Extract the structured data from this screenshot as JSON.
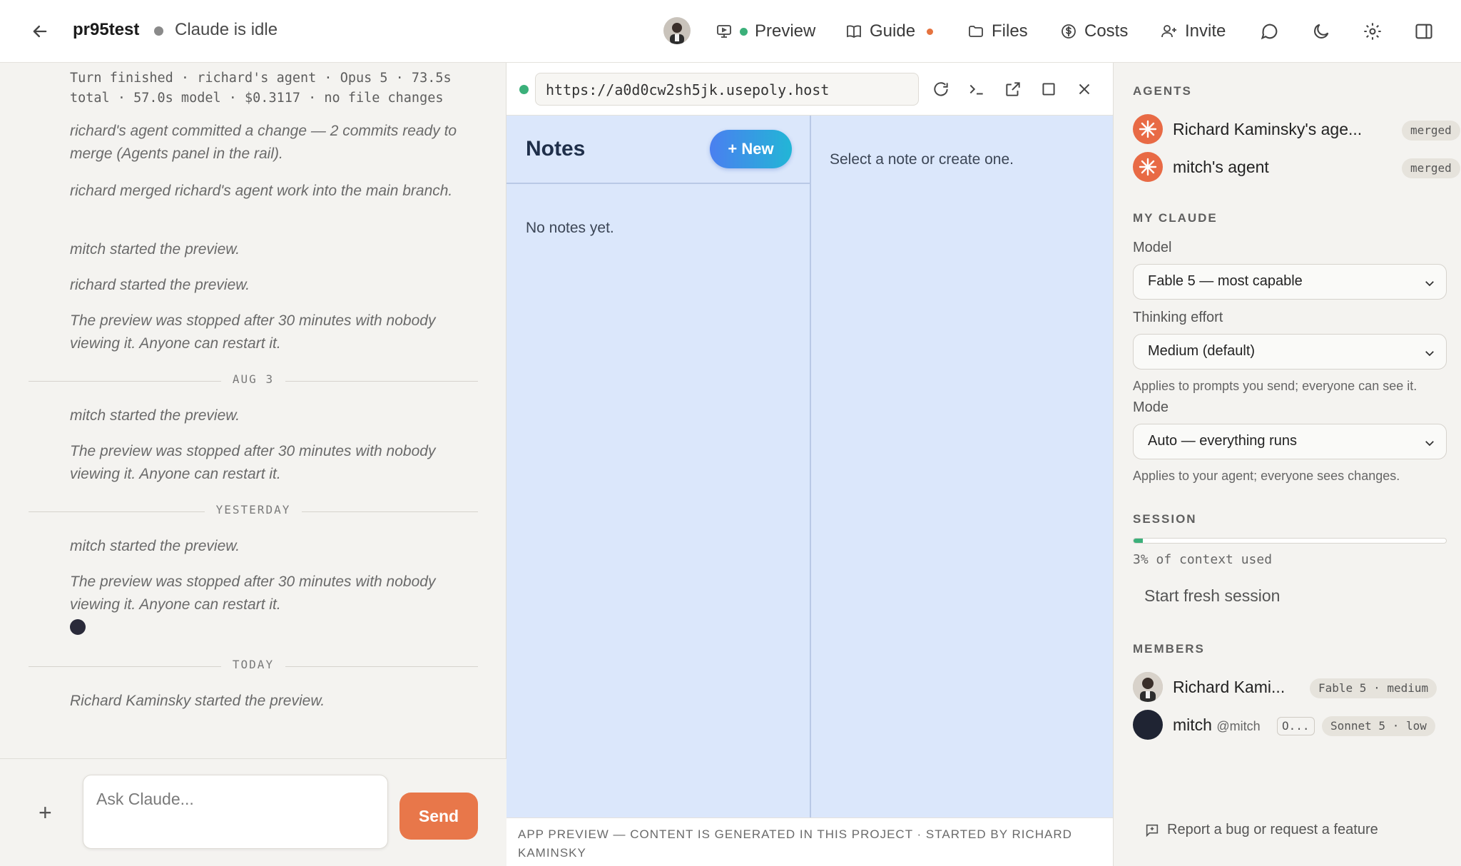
{
  "header": {
    "project": "pr95test",
    "status": "Claude is idle",
    "nav": {
      "preview": "Preview",
      "guide": "Guide",
      "files": "Files",
      "costs": "Costs",
      "invite": "Invite"
    }
  },
  "chat": {
    "turn_summary": "Turn finished · richard's agent · Opus 5 · 73.5s total · 57.0s model · $0.3117 · no file changes",
    "messages": [
      "richard's agent committed a change — 2 commits ready to merge (Agents panel in the rail).",
      "richard merged richard's agent work into the main branch.",
      "mitch started the preview.",
      "richard started the preview.",
      "The preview was stopped after 30 minutes with nobody viewing it. Anyone can restart it.",
      "mitch started the preview.",
      "The preview was stopped after 30 minutes with nobody viewing it. Anyone can restart it.",
      "mitch started the preview.",
      "The preview was stopped after 30 minutes with nobody viewing it. Anyone can restart it.",
      "Richard Kaminsky started the preview."
    ],
    "separators": [
      "AUG 3",
      "YESTERDAY",
      "TODAY"
    ],
    "composer_placeholder": "Ask Claude...",
    "send_label": "Send"
  },
  "preview": {
    "url": "https://a0d0cw2sh5jk.usepoly.host",
    "notes_title": "Notes",
    "new_button": "+ New",
    "empty_text": "No notes yet.",
    "select_text": "Select a note or create one.",
    "footer": "APP PREVIEW — CONTENT IS GENERATED IN THIS PROJECT · STARTED BY RICHARD KAMINSKY"
  },
  "rail": {
    "agents_heading": "AGENTS",
    "agents": [
      {
        "name": "Richard Kaminsky's age...",
        "badge": "merged"
      },
      {
        "name": "mitch's agent",
        "badge": "merged"
      }
    ],
    "my_claude_heading": "MY CLAUDE",
    "model_label": "Model",
    "model_value": "Fable 5 — most capable",
    "effort_label": "Thinking effort",
    "effort_value": "Medium (default)",
    "effort_hint": "Applies to prompts you send; everyone can see it.",
    "mode_label": "Mode",
    "mode_value": "Auto — everything runs",
    "mode_hint": "Applies to your agent; everyone sees changes.",
    "session_heading": "SESSION",
    "context_used_pct": 3,
    "context_text": "3% of context used",
    "fresh_session": "Start fresh session",
    "members_heading": "MEMBERS",
    "members": [
      {
        "name": "Richard Kami...",
        "handle": "",
        "tag": "",
        "badge": "Fable 5 · medium"
      },
      {
        "name": "mitch",
        "handle": "@mitch",
        "tag": "O...",
        "badge": "Sonnet 5 · low"
      }
    ],
    "report": "Report a bug or request a feature"
  },
  "colors": {
    "accent": "#e8774a",
    "live": "#3bb07a",
    "app_bg": "#dbe7fb"
  }
}
